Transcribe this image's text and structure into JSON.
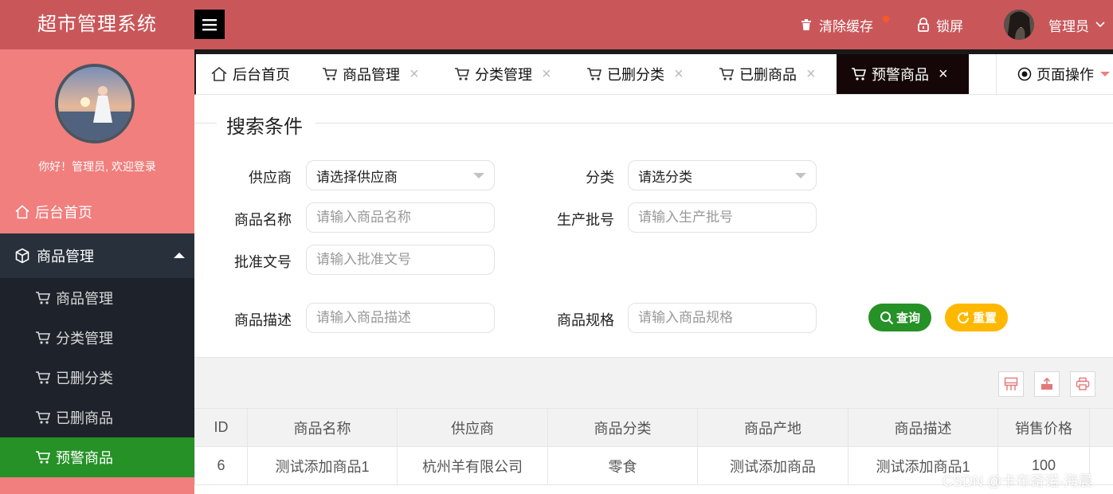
{
  "header": {
    "logo": "超市管理系统",
    "clear_cache": "清除缓存",
    "lock_screen": "锁屏",
    "user": "管理员"
  },
  "sidebar": {
    "greeting": "你好！管理员, 欢迎登录",
    "home": "后台首页",
    "group": "商品管理",
    "items": [
      {
        "label": "商品管理"
      },
      {
        "label": "分类管理"
      },
      {
        "label": "已删分类"
      },
      {
        "label": "已删商品"
      },
      {
        "label": "预警商品"
      }
    ]
  },
  "tabs": [
    {
      "label": "后台首页"
    },
    {
      "label": "商品管理"
    },
    {
      "label": "分类管理"
    },
    {
      "label": "已删分类"
    },
    {
      "label": "已删商品"
    },
    {
      "label": "预警商品"
    }
  ],
  "page_op": "页面操作",
  "search": {
    "title": "搜索条件",
    "supplier_label": "供应商",
    "supplier_value": "请选择供应商",
    "category_label": "分类",
    "category_value": "请选分类",
    "name_label": "商品名称",
    "name_placeholder": "请输入商品名称",
    "batch_label": "生产批号",
    "batch_placeholder": "请输入生产批号",
    "approval_label": "批准文号",
    "approval_placeholder": "请输入批准文号",
    "desc_label": "商品描述",
    "desc_placeholder": "请输入商品描述",
    "spec_label": "商品规格",
    "spec_placeholder": "请输入商品规格",
    "query_btn": "查询",
    "reset_btn": "重置"
  },
  "table": {
    "columns": [
      "ID",
      "商品名称",
      "供应商",
      "商品分类",
      "商品产地",
      "商品描述",
      "销售价格"
    ],
    "rows": [
      [
        "6",
        "测试添加商品1",
        "杭州羊有限公司",
        "零食",
        "测试添加商品",
        "测试添加商品1",
        "100"
      ]
    ]
  },
  "watermark": "CSDN @卡布奇诺-海晨",
  "colors": {
    "header_bg": "#c9575a",
    "sidebar_bg": "#f07f7d",
    "active_green": "#259126",
    "query_green": "#259126",
    "reset_yellow": "#ffb800"
  }
}
